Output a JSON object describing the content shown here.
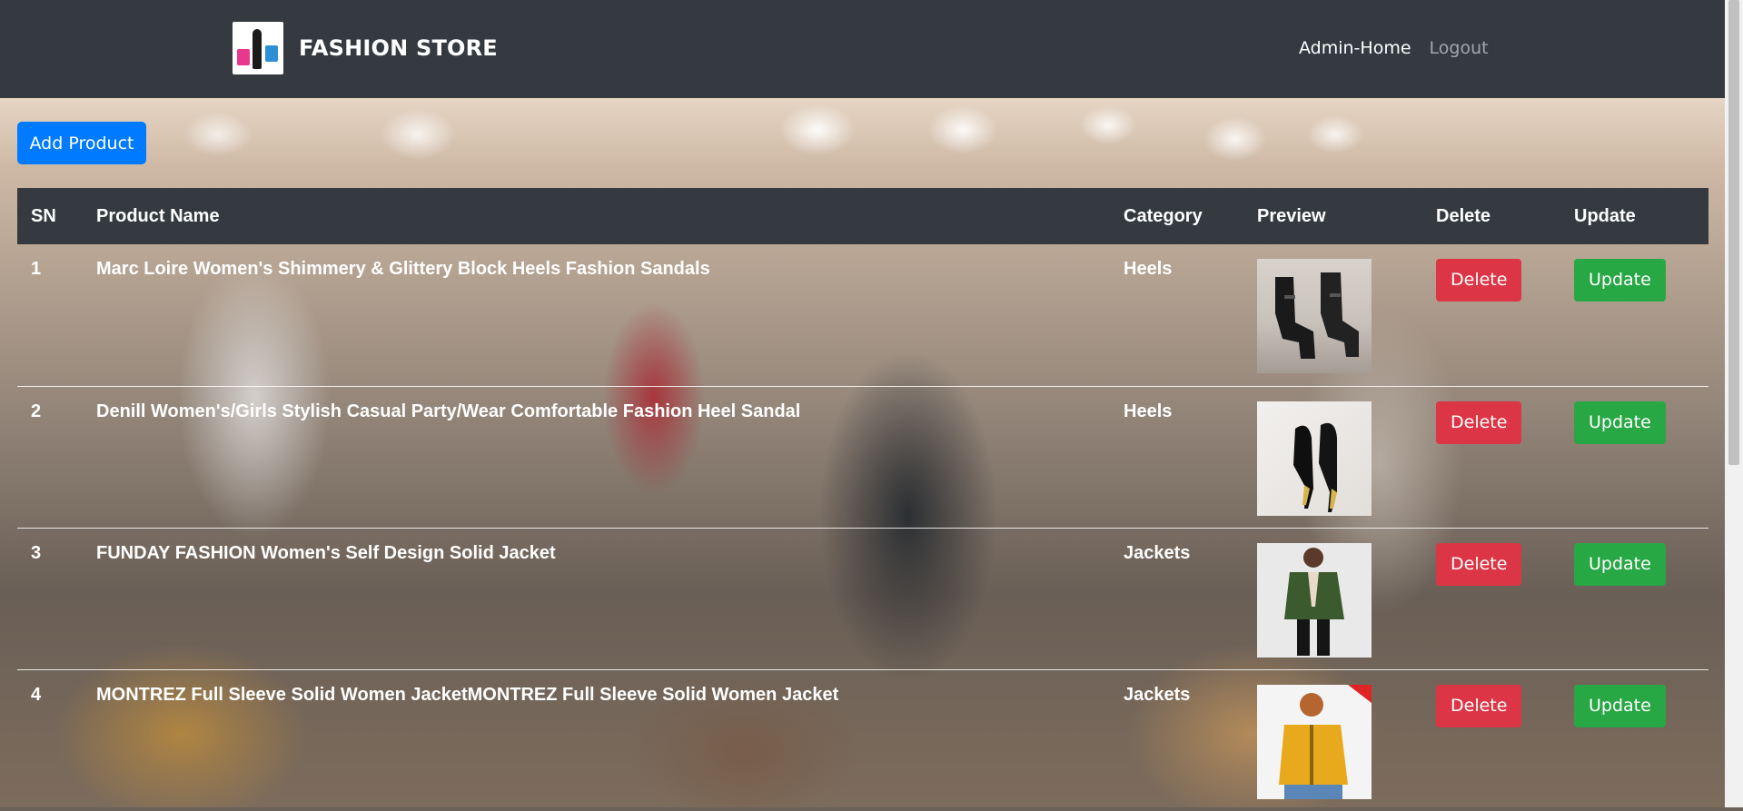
{
  "navbar": {
    "brand": "FASHION STORE",
    "links": [
      "Admin-Home",
      "Logout"
    ]
  },
  "add_button": "Add Product",
  "table": {
    "headers": [
      "SN",
      "Product Name",
      "Category",
      "Preview",
      "Delete",
      "Update"
    ],
    "rows": [
      {
        "sn": "1",
        "name": "Marc Loire Women's Shimmery & Glittery Block Heels Fashion Sandals",
        "category": "Heels",
        "preview_icon": "black-block-heel-sandals-image",
        "delete": "Delete",
        "update": "Update"
      },
      {
        "sn": "2",
        "name": "Denill Women's/Girls Stylish Casual Party/Wear Comfortable Fashion Heel Sandal",
        "category": "Heels",
        "preview_icon": "black-stiletto-heels-image",
        "delete": "Delete",
        "update": "Update"
      },
      {
        "sn": "3",
        "name": "FUNDAY FASHION Women's Self Design Solid Jacket",
        "category": "Jackets",
        "preview_icon": "green-leather-jacket-image",
        "delete": "Delete",
        "update": "Update"
      },
      {
        "sn": "4",
        "name": "MONTREZ Full Sleeve Solid Women JacketMONTREZ Full Sleeve Solid Women Jacket",
        "category": "Jackets",
        "preview_icon": "yellow-puffer-jacket-image",
        "delete": "Delete",
        "update": "Update"
      }
    ]
  },
  "colors": {
    "navbar": "#343a40",
    "primary": "#007bff",
    "danger": "#dc3545",
    "success": "#28a745"
  }
}
